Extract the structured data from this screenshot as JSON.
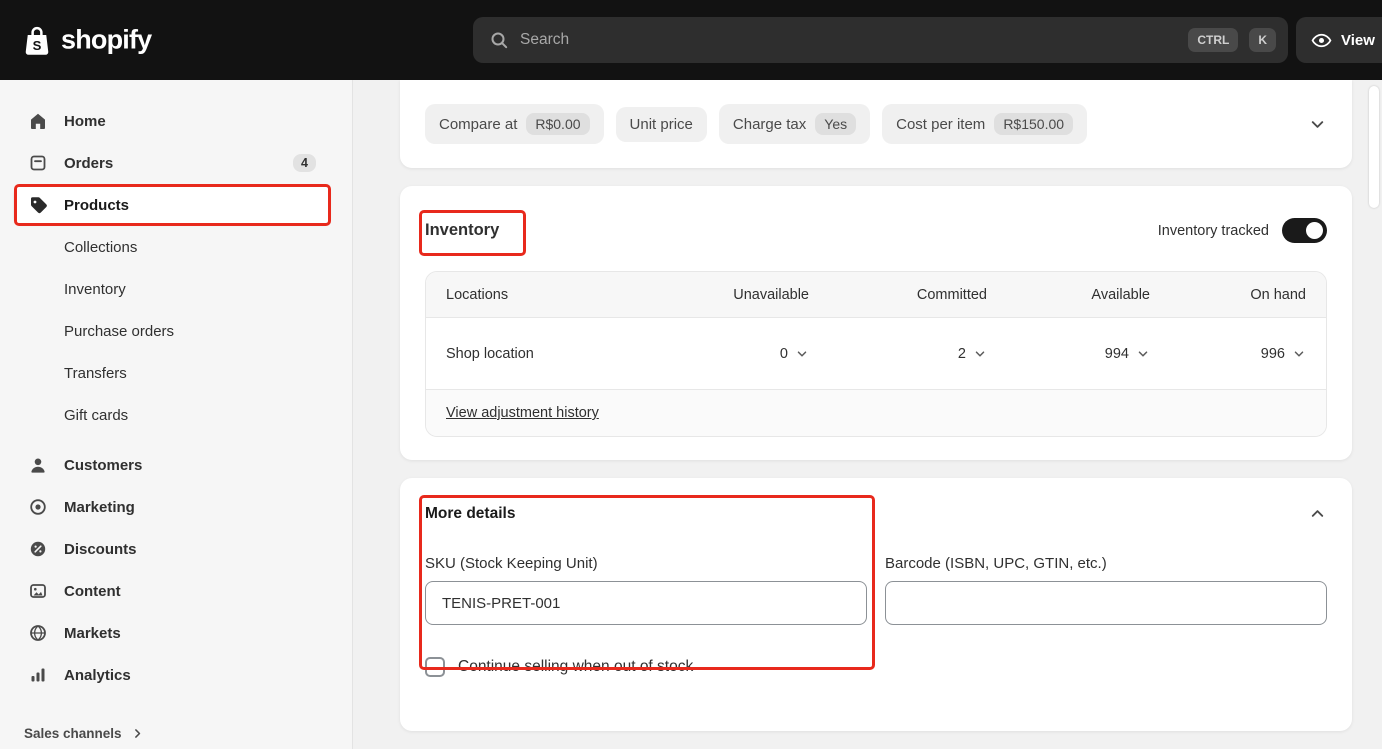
{
  "topbar": {
    "logo_text": "shopify",
    "search": {
      "placeholder": "Search",
      "key_ctrl": "CTRL",
      "key_k": "K"
    },
    "view_label": "View"
  },
  "sidebar": {
    "items": [
      {
        "label": "Home"
      },
      {
        "label": "Orders",
        "badge": "4"
      },
      {
        "label": "Products"
      },
      {
        "label": "Customers"
      },
      {
        "label": "Marketing"
      },
      {
        "label": "Discounts"
      },
      {
        "label": "Content"
      },
      {
        "label": "Markets"
      },
      {
        "label": "Analytics"
      }
    ],
    "product_subitems": [
      {
        "label": "Collections"
      },
      {
        "label": "Inventory"
      },
      {
        "label": "Purchase orders"
      },
      {
        "label": "Transfers"
      },
      {
        "label": "Gift cards"
      }
    ],
    "sales_channels_label": "Sales channels"
  },
  "pricing_card": {
    "pills": [
      {
        "label": "Compare at",
        "badge": "R$0.00"
      },
      {
        "label": "Unit price"
      },
      {
        "label": "Charge tax",
        "badge": "Yes"
      },
      {
        "label": "Cost per item",
        "badge": "R$150.00"
      }
    ]
  },
  "inventory_card": {
    "title": "Inventory",
    "tracked_label": "Inventory tracked",
    "tracked_on": true,
    "table": {
      "headers": [
        "Locations",
        "Unavailable",
        "Committed",
        "Available",
        "On hand"
      ],
      "row": {
        "location": "Shop location",
        "unavailable": "0",
        "committed": "2",
        "available": "994",
        "on_hand": "996"
      }
    },
    "history_link": "View adjustment history"
  },
  "more_details_card": {
    "title": "More details",
    "sku_label": "SKU (Stock Keeping Unit)",
    "sku_value": "TENIS-PRET-001",
    "barcode_label": "Barcode (ISBN, UPC, GTIN, etc.)",
    "barcode_value": "",
    "checkbox_label": "Continue selling when out of stock",
    "checkbox_checked": false
  },
  "colors": {
    "annotation_red": "#e8291c",
    "topbar_bg": "#121212",
    "toggle_on": "#1a1a1a"
  }
}
